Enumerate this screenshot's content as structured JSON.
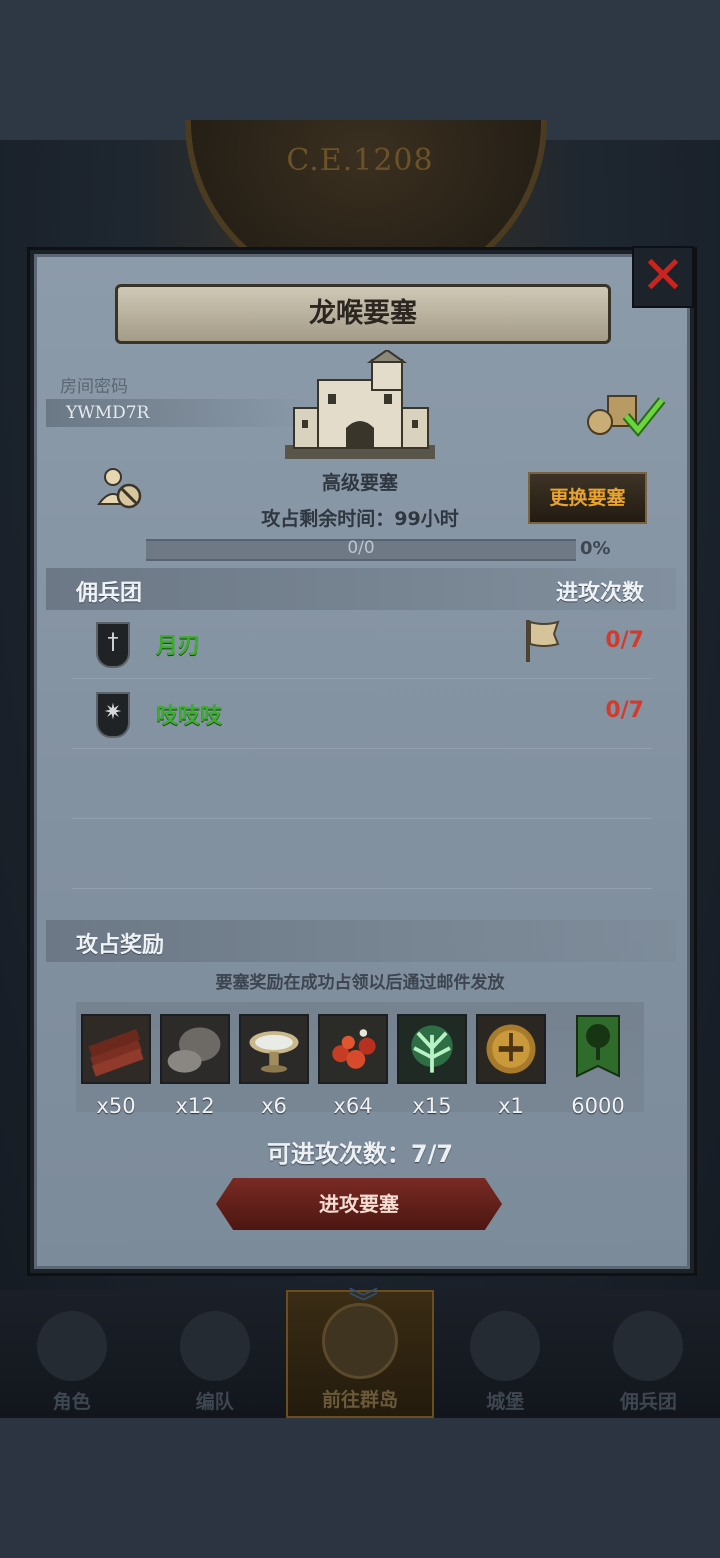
{
  "background": {
    "era": "C.E.1208"
  },
  "dialog": {
    "title": "龙喉要塞",
    "room_label": "房间密码",
    "room_code": "YWMD7R",
    "fort_level": "高级要塞",
    "time_left": "攻占剩余时间：99小时",
    "change_fort_label": "更换要塞",
    "progress": {
      "text": "0/0",
      "percent_label": "0%",
      "value": 0
    },
    "mercenary_header": "佣兵团",
    "attack_times_header": "进攻次数",
    "mercenaries": [
      {
        "name": "月刃",
        "count": "0/7",
        "icon": "sword-crest-icon",
        "has_flag": true
      },
      {
        "name": "吱吱吱",
        "count": "0/7",
        "icon": "flame-crest-icon",
        "has_flag": false
      }
    ],
    "reward_header": "攻占奖励",
    "reward_note": "要塞奖励在成功占领以后通过邮件发放",
    "rewards": [
      {
        "icon": "wood-logs-icon",
        "qty": "x50"
      },
      {
        "icon": "ore-stone-icon",
        "qty": "x12"
      },
      {
        "icon": "water-bowl-icon",
        "qty": "x6"
      },
      {
        "icon": "berries-icon",
        "qty": "x64"
      },
      {
        "icon": "green-crystal-icon",
        "qty": "x15"
      },
      {
        "icon": "golden-helmet-icon",
        "qty": "x1"
      },
      {
        "icon": "tree-banner-icon",
        "qty": "6000"
      }
    ],
    "attack_count": "可进攻次数：7/7",
    "attack_button": "进攻要塞"
  },
  "nav": {
    "items": [
      {
        "label": "角色",
        "active": false
      },
      {
        "label": "编队",
        "active": false
      },
      {
        "label": "前往群岛",
        "active": true
      },
      {
        "label": "城堡",
        "active": false
      },
      {
        "label": "佣兵团",
        "active": false
      }
    ]
  },
  "colors": {
    "gold": "#e9a32f",
    "green_name": "#3cae2e",
    "red_count": "#d23b2c",
    "attack_red": "#7a2a24"
  }
}
